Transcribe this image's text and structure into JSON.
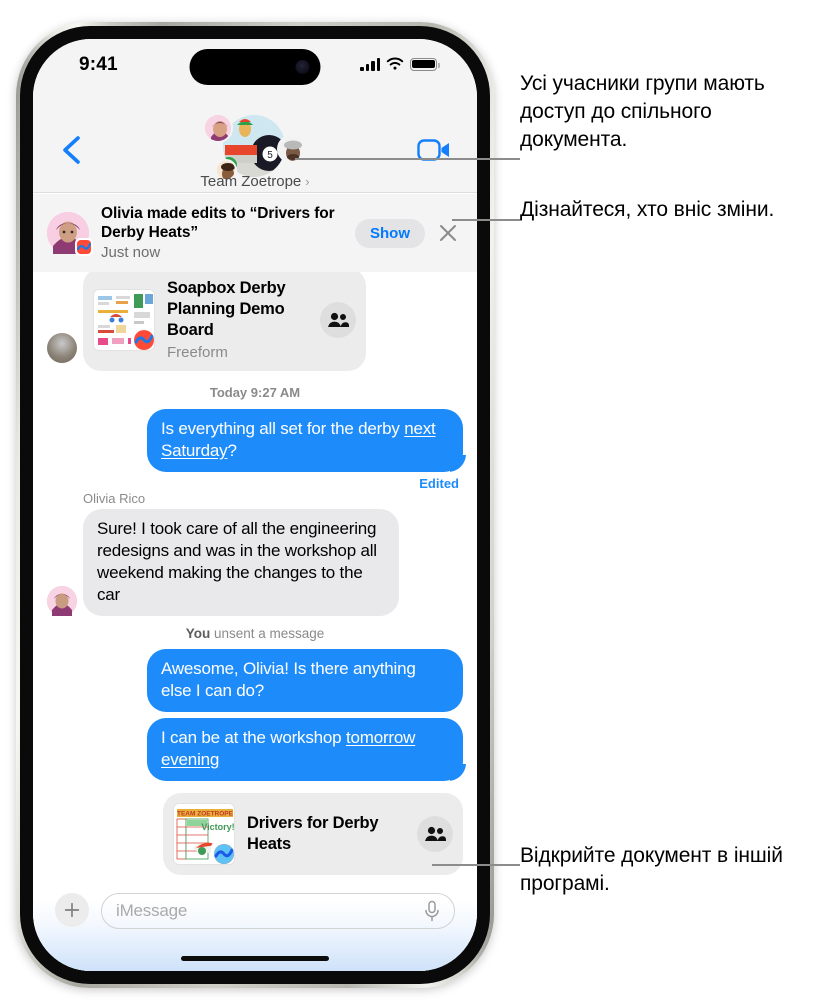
{
  "status_bar": {
    "time": "9:41",
    "cellular_icon": "cellular-signal-icon",
    "wifi_icon": "wifi-icon",
    "battery_icon": "battery-icon"
  },
  "nav_bar": {
    "back_icon": "back-chevron-icon",
    "facetime_icon": "video-camera-icon",
    "group_title": "Team Zoetrope",
    "group_chevron": "›"
  },
  "notification": {
    "title": "Olivia made edits to “Drivers for Derby Heats”",
    "subtitle": "Just now",
    "show_label": "Show",
    "close_icon": "close-x-icon",
    "avatar": "olivia-avatar",
    "app_badge": "freeform-app-badge"
  },
  "messages": {
    "link_card_top": {
      "title": "Soapbox Derby Planning Demo Board",
      "subtitle": "Freeform",
      "thumb": "freeform-board-thumbnail",
      "people_icon": "people-icon"
    },
    "timestamp": "Today 9:27 AM",
    "bubble_1": {
      "text_before": "Is everything all set for the derby ",
      "text_link": "next Saturday",
      "text_after": "?",
      "edited_label": "Edited"
    },
    "sender_name": "Olivia Rico",
    "bubble_2": {
      "text": "Sure! I took care of all the engineering redesigns and was in the workshop all weekend making the changes to the car"
    },
    "unsent_note_bold": "You",
    "unsent_note_rest": " unsent a message",
    "bubble_3": {
      "text": "Awesome, Olivia! Is there anything else I can do?"
    },
    "bubble_4": {
      "text_before": "I can be at the workshop ",
      "text_link": "tomorrow evening"
    },
    "link_card_bottom": {
      "title": "Drivers for Derby Heats",
      "thumb": "derby-heats-thumbnail",
      "people_icon": "people-icon"
    }
  },
  "input_bar": {
    "plus_icon": "plus-icon",
    "placeholder": "iMessage",
    "mic_icon": "microphone-icon"
  },
  "annotations": {
    "a1": "Усі учасники групи мають доступ до спільного документа.",
    "a2": "Дізнайтеся, хто вніс зміни.",
    "a3": "Відкрийте документ в іншій програмі."
  },
  "colors": {
    "accent_blue": "#1e8bfb",
    "link_blue": "#007aff",
    "bubble_grey": "#e9e9eb",
    "chrome_grey": "#f4f4f4"
  }
}
